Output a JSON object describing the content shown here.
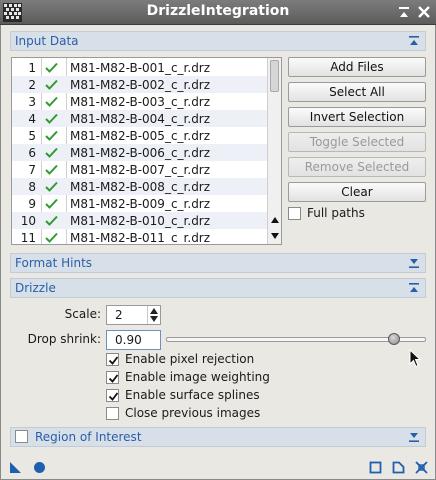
{
  "window": {
    "title": "DrizzleIntegration"
  },
  "sections": {
    "input_data": "Input Data",
    "format_hints": "Format Hints",
    "drizzle": "Drizzle",
    "region_of_interest": "Region of Interest"
  },
  "files": [
    {
      "num": "1",
      "name": "M81-M82-B-001_c_r.drz"
    },
    {
      "num": "2",
      "name": "M81-M82-B-002_c_r.drz"
    },
    {
      "num": "3",
      "name": "M81-M82-B-003_c_r.drz"
    },
    {
      "num": "4",
      "name": "M81-M82-B-004_c_r.drz"
    },
    {
      "num": "5",
      "name": "M81-M82-B-005_c_r.drz"
    },
    {
      "num": "6",
      "name": "M81-M82-B-006_c_r.drz"
    },
    {
      "num": "7",
      "name": "M81-M82-B-007_c_r.drz"
    },
    {
      "num": "8",
      "name": "M81-M82-B-008_c_r.drz"
    },
    {
      "num": "9",
      "name": "M81-M82-B-009_c_r.drz"
    },
    {
      "num": "10",
      "name": "M81-M82-B-010_c_r.drz"
    },
    {
      "num": "11",
      "name": "M81-M82-B-011_c_r.drz"
    }
  ],
  "buttons": {
    "add_files": "Add Files",
    "select_all": "Select All",
    "invert_selection": "Invert Selection",
    "toggle_selected": "Toggle Selected",
    "remove_selected": "Remove Selected",
    "clear": "Clear"
  },
  "full_paths": {
    "label": "Full paths",
    "checked": false
  },
  "drizzle": {
    "scale_label": "Scale:",
    "scale_value": "2",
    "drop_shrink_label": "Drop shrink:",
    "drop_shrink_value": "0.90",
    "drop_shrink_slider": 0.9,
    "enable_pixel_rejection": {
      "label": "Enable pixel rejection",
      "checked": true
    },
    "enable_image_weighting": {
      "label": "Enable image weighting",
      "checked": true
    },
    "enable_surface_splines": {
      "label": "Enable surface splines",
      "checked": true
    },
    "close_previous_images": {
      "label": "Close previous images",
      "checked": false
    }
  },
  "colors": {
    "title_bar": "#6a6a6a",
    "section_header": "#d7dfe9",
    "section_text": "#2a5fa6",
    "check_green": "#2e9b2e",
    "bottom_icons": "#1f5fb0"
  }
}
